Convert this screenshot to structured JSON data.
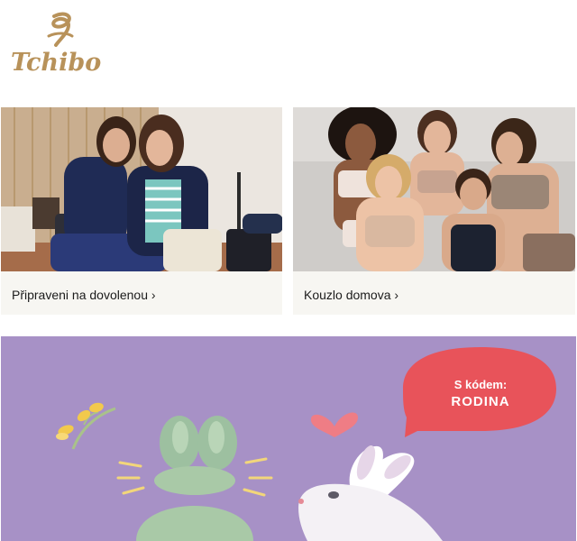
{
  "brand": {
    "logo_text": "Tchibo",
    "logo_color": "#b8925a"
  },
  "cards": [
    {
      "label": "Připraveni na dovolenou ›"
    },
    {
      "label": "Kouzlo domova ›"
    }
  ],
  "promo": {
    "line1": "S kódem:",
    "line2": "RODINA",
    "background": "#a791c6",
    "bubble_color": "#e8535a"
  }
}
